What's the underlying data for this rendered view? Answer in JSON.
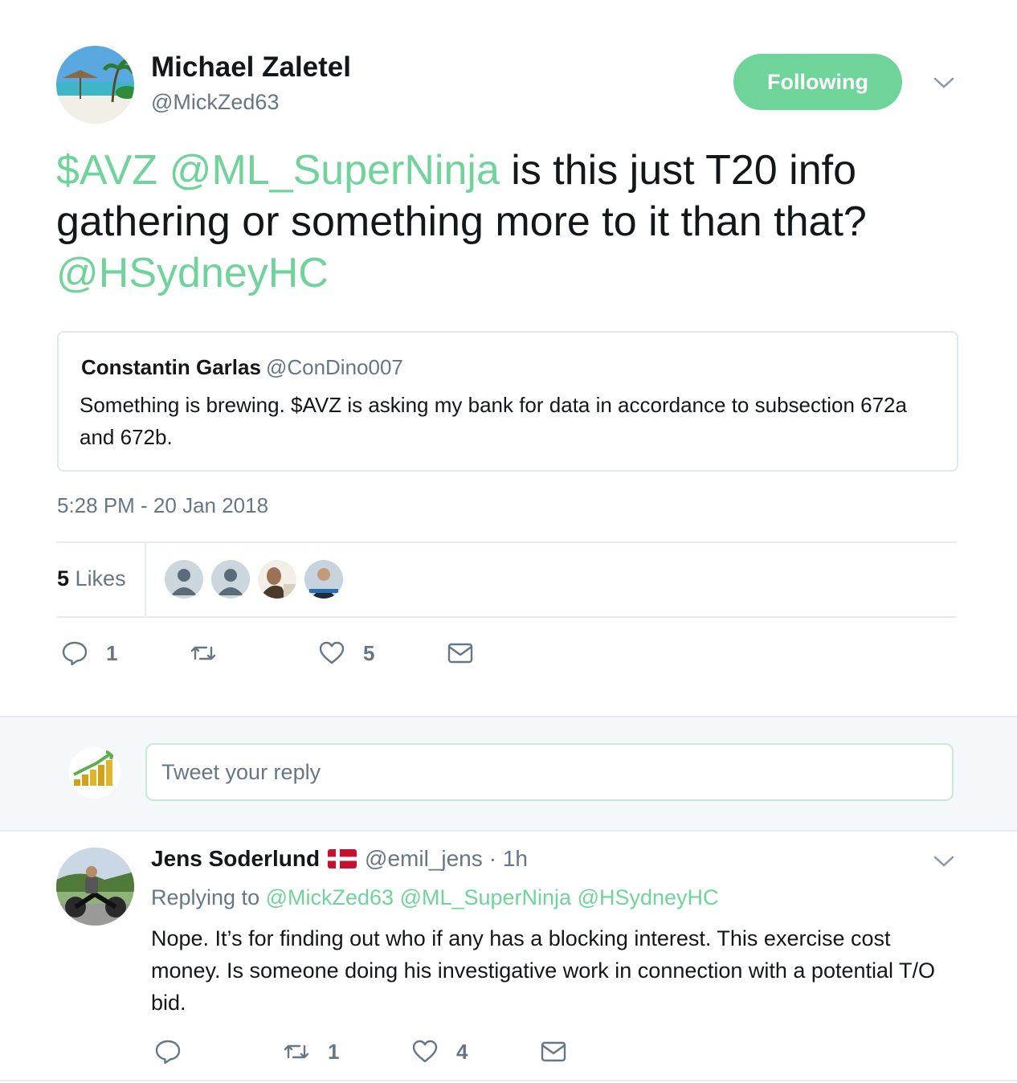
{
  "tweet": {
    "author_name": "Michael Zaletel",
    "author_handle": "@MickZed63",
    "follow_label": "Following",
    "text_parts": {
      "cashtag": "$AVZ",
      "mention1": "@ML_SuperNinja",
      "body": " is this just T20 info gathering or something more to it than that? ",
      "mention2": "@HSydneyHC"
    },
    "quote": {
      "name": "Constantin Garlas",
      "handle": "@ConDino007",
      "text": "Something is brewing. $AVZ is asking my bank for data in accordance to subsection 672a and 672b."
    },
    "timestamp": "5:28 PM - 20 Jan 2018",
    "likes_count": "5",
    "likes_label": "Likes",
    "actions": {
      "replies": "1",
      "retweets": "",
      "likes": "5"
    }
  },
  "reply_box": {
    "placeholder": "Tweet your reply"
  },
  "reply": {
    "name": "Jens Soderlund",
    "handle": "@emil_jens",
    "time": "· 1h",
    "replying_prefix": "Replying to",
    "replying_to": "@MickZed63 @ML_SuperNinja @HSydneyHC",
    "text": "Nope. It’s for finding out who if any has a blocking interest. This exercise cost money. Is someone doing his investigative work in connection with a potential T/O bid.",
    "actions": {
      "replies": "",
      "retweets": "1",
      "likes": "4"
    }
  },
  "colors": {
    "accent": "#6fd49a",
    "secondary_text": "#657786",
    "primary_text": "#14171a",
    "border": "#e6ecf0"
  },
  "icons": [
    "chevron-down-icon",
    "reply-icon",
    "retweet-icon",
    "heart-icon",
    "message-icon",
    "flag-denmark-icon"
  ]
}
